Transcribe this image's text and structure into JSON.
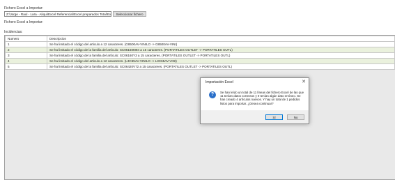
{
  "form": {
    "field_label_top": "Fichero Excel a Importar:",
    "path_value": "Z:\\Jorge - Raul - Lara - Aliqui\\Excel Referencial\\Excel preparados Total\\Exc",
    "select_button": "Seleccionar fichero",
    "field_label_bottom": "Fichero Excel a Importar:"
  },
  "incidencias": {
    "label": "Incidencias:",
    "columns": [
      "Numero",
      "Descripcion"
    ],
    "rows": [
      {
        "numero": "1",
        "descripcion": "Se ha limitado el código del articulo a 12 caracteres. (G8500AV-VINILO -> G8500AV-VINI)"
      },
      {
        "numero": "2",
        "descripcion": "Se ha limitado el código de la familia del artículo: SC06160M94 a 15 caracteres. (PORTATILES OUTLET -> PORTATILES OUTL)"
      },
      {
        "numero": "3",
        "descripcion": "Se ha limitado el código de la familia del artículo: SC06160Y3 a 15 caracteres. (PORTATILES OUTLET -> PORTATILES OUTL)"
      },
      {
        "numero": "4",
        "descripcion": "Se ha limitado el código del articulo a 12 caracteres. (L3C65AV-VINILO -> L3C65AV-VINI)"
      },
      {
        "numero": "5",
        "descripcion": "Se ha limitado el código de la familia del artículo: SC06420V72 a 15 caracteres. (PORTATILES OUTLET -> PORTATILES OUTL)"
      }
    ]
  },
  "dialog": {
    "title": "Importación Excel",
    "close": "✕",
    "icon": "question-icon",
    "icon_glyph": "?",
    "message": "Se han leído un total de 11 líneas del fichero Excel de las que 11 tenían datos correctos y 0 tenían algún dato erróneo. Se han creado 4 artículos nuevos. Y hay un total de 1 pedidos listos para importar. ¿Desea continuar?",
    "yes_label": "Sí",
    "no_label": "No"
  },
  "colors": {
    "alt_row": "#eaf1dd",
    "icon": "#2a6fc9",
    "grid_bg": "#e9e9e9"
  }
}
